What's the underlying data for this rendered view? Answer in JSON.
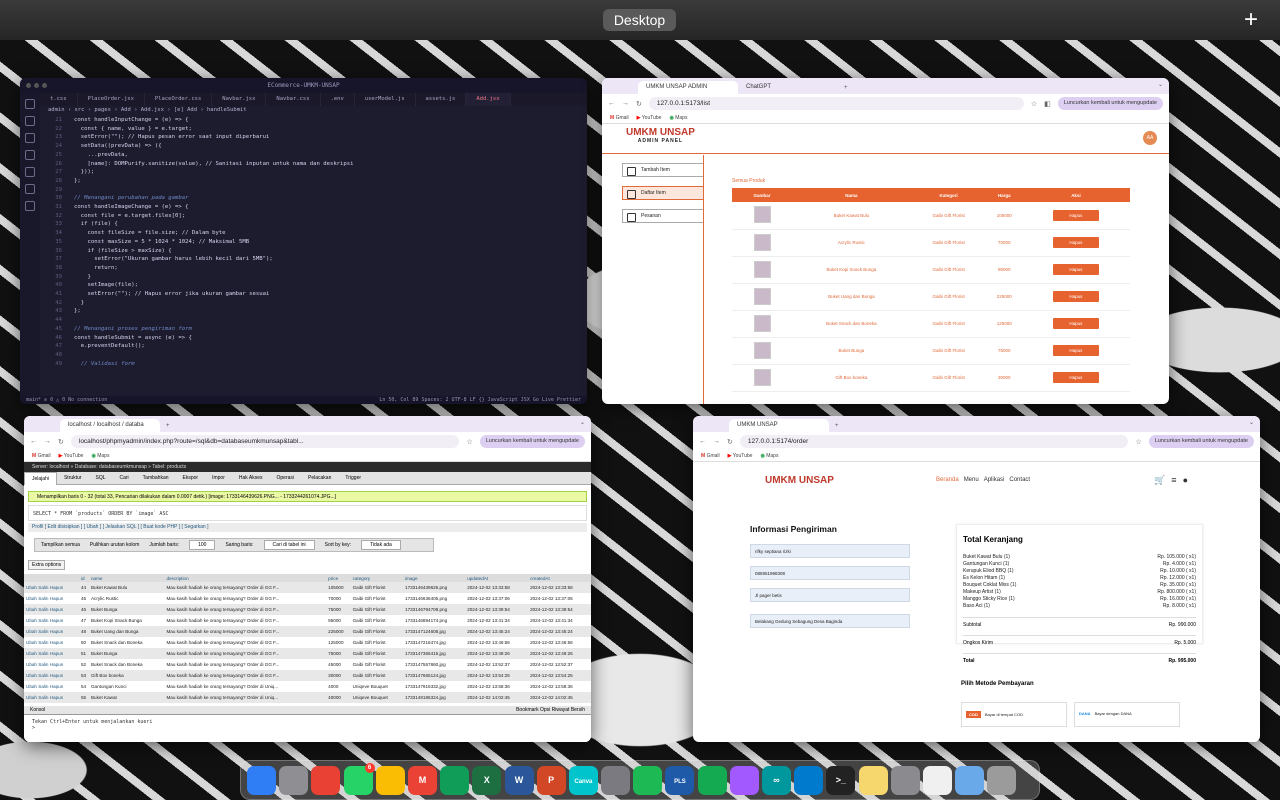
{
  "desktop": {
    "label": "Desktop",
    "add_space": "+"
  },
  "vscode": {
    "title": "ECommerce-UMKM-UNSAP",
    "tabs": [
      "t.css",
      "PlaceOrder.jsx",
      "PlaceOrder.css",
      "Navbar.jsx",
      "Navbar.css",
      ".env",
      "userModel.js",
      "assets.js",
      "Add.jsx"
    ],
    "breadcrumb": "admin › src › pages › Add › Add.jsx › [e] Add › handleSubmit",
    "lines": [
      {
        "n": "21",
        "t": "const handleInputChange = (e) => {"
      },
      {
        "n": "22",
        "t": "  const { name, value } = e.target;"
      },
      {
        "n": "23",
        "t": "  setError(\"\"); // Hapus pesan error saat input diperbarui"
      },
      {
        "n": "24",
        "t": "  setData((prevData) => ({"
      },
      {
        "n": "25",
        "t": "    ...prevData,"
      },
      {
        "n": "26",
        "t": "    [name]: DOMPurify.sanitize(value), // Sanitasi inputan untuk nama dan deskripsi"
      },
      {
        "n": "27",
        "t": "  }));"
      },
      {
        "n": "28",
        "t": "};"
      },
      {
        "n": "29",
        "t": ""
      },
      {
        "n": "30",
        "t": "// Menangani perubahan pada gambar"
      },
      {
        "n": "31",
        "t": "const handleImageChange = (e) => {"
      },
      {
        "n": "32",
        "t": "  const file = e.target.files[0];"
      },
      {
        "n": "33",
        "t": "  if (file) {"
      },
      {
        "n": "34",
        "t": "    const fileSize = file.size; // Dalam byte"
      },
      {
        "n": "35",
        "t": "    const maxSize = 5 * 1024 * 1024; // Maksimal 5MB"
      },
      {
        "n": "36",
        "t": "    if (fileSize > maxSize) {"
      },
      {
        "n": "37",
        "t": "      setError(\"Ukuran gambar harus lebih kecil dari 5MB\");"
      },
      {
        "n": "38",
        "t": "      return;"
      },
      {
        "n": "39",
        "t": "    }"
      },
      {
        "n": "40",
        "t": "    setImage(file);"
      },
      {
        "n": "41",
        "t": "    setError(\"\"); // Hapus error jika ukuran gambar sesuai"
      },
      {
        "n": "42",
        "t": "  }"
      },
      {
        "n": "43",
        "t": "};"
      },
      {
        "n": "44",
        "t": ""
      },
      {
        "n": "45",
        "t": "// Menangani proses pengiriman form"
      },
      {
        "n": "46",
        "t": "const handleSubmit = async (e) => {"
      },
      {
        "n": "47",
        "t": "  e.preventDefault();"
      },
      {
        "n": "48",
        "t": ""
      },
      {
        "n": "49",
        "t": "  // Validasi form"
      }
    ],
    "status_left": "main* ⊘ 0 △ 0   No connection",
    "status_right": "Ln 50, Col 89  Spaces: 2  UTF-8  LF  {} JavaScript JSX  Go Live  Prettier"
  },
  "admin": {
    "tabs": [
      "UMKM UNSAP ADMIN",
      "ChatGPT"
    ],
    "url": "127.0.0.1:5173/list",
    "update": "Luncurkan kembali untuk mengupdate",
    "bookmarks": [
      "Gmail",
      "YouTube",
      "Maps"
    ],
    "logo": "UMKM UNSAP",
    "logo_sub": "ADMIN PANEL",
    "avatar": "AA",
    "sidebar": [
      "Tambah Item",
      "Daftar Item",
      "Pesanan"
    ],
    "caption": "Semua Produk",
    "headers": [
      "Gambar",
      "Nama",
      "Kategori",
      "Harga",
      "Aksi"
    ],
    "rows": [
      {
        "name": "Buket Kawat Bulu",
        "cat": "Gaibi Gift Florist",
        "price": "105000"
      },
      {
        "name": "Acrylic Rustic",
        "cat": "Gaibi Gift Florist",
        "price": "70000"
      },
      {
        "name": "Buket Kopi Snack Bunga",
        "cat": "Gaibi Gift Florist",
        "price": "95000"
      },
      {
        "name": "Buket Uang dan Bunga",
        "cat": "Gaibi Gift Florist",
        "price": "225000"
      },
      {
        "name": "Buket Snack dan Boneka",
        "cat": "Gaibi Gift Florist",
        "price": "125000"
      },
      {
        "name": "Buket Bunga",
        "cat": "Gaibi Gift Florist",
        "price": "75000"
      },
      {
        "name": "Gift Box boneka",
        "cat": "Gaibi Gift Florist",
        "price": "30000"
      }
    ],
    "delete_label": "Hapus"
  },
  "pma": {
    "tab": "localhost / localhost / databa",
    "url": "localhost/phpmyadmin/index.php?route=/sql&db=databaseumkmunsap&tabl...",
    "update": "Luncurkan kembali untuk mengupdate",
    "bookmarks": [
      "Gmail",
      "YouTube",
      "Maps"
    ],
    "nav": "Server: localhost » Database: databaseumkmunsap » Tabel: products",
    "tabs": [
      "Jelajahi",
      "Struktur",
      "SQL",
      "Cari",
      "Tambahkan",
      "Ekspor",
      "Impor",
      "Hak Akses",
      "Operasi",
      "Pelacakan",
      "Trigger"
    ],
    "message": "Menampilkan baris 0 - 32 (total 33, Pencarian dilakukan dalam 0.0007 detik.) [image: 1733146439626.PNG... - 1733244261074.JPG...]",
    "sql": "SELECT * FROM `products` ORDER BY `image` ASC",
    "links": "Profil [ Edit disisipkan ] [ Ubah ] [ Jelaskan SQL ] [ Buat kode PHP ] [ Segarkan ]",
    "opt_all": "Tampilkan semua",
    "opt_cols": "Pulihkan urutan kolom",
    "opt_rows": "Jumlah baris:",
    "opt_rows_val": "100",
    "opt_filter": "Saring baris:",
    "opt_filter_ph": "Cari di tabel ini",
    "opt_sort": "Sort by key:",
    "opt_sort_val": "Tidak ada",
    "extra": "Extra options",
    "columns": [
      "",
      "id",
      "name",
      "description",
      "price",
      "category",
      "image",
      "updatedAt",
      "createdAt"
    ],
    "actions": "Ubah  Salin  Hapus",
    "rows": [
      [
        "44",
        "Buket Kawat Bulu",
        "Mau kasih hadiah ke orang tersayang? Order di GG F...",
        "105000",
        "Gaibi Gift Florist",
        "1733146439626.png",
        "2024-12-02 13:33:58",
        "2024-12-02 13:33:58"
      ],
      [
        "45",
        "Acrylic Rustic",
        "Mau kasih hadiah ke orang tersayang? Order di GG F...",
        "70000",
        "Gaibi Gift Florist",
        "1733146636405.png",
        "2024-12-02 13:37:06",
        "2024-12-02 13:37:06"
      ],
      [
        "46",
        "Buket Bunga",
        "Mau kasih hadiah ke orang tersayang? Order di GG F...",
        "75000",
        "Gaibi Gift Florist",
        "1733146794708.png",
        "2024-12-02 13:39:54",
        "2024-12-02 13:39:54"
      ],
      [
        "47",
        "Buket Kopi Snack Bunga",
        "Mau kasih hadiah ke orang tersayang? Order di GG F...",
        "95000",
        "Gaibi Gift Florist",
        "1733146894174.png",
        "2024-12-02 13:41:34",
        "2024-12-02 13:41:34"
      ],
      [
        "48",
        "Buket Uang dan Bunga",
        "Mau kasih hadiah ke orang tersayang? Order di GG F...",
        "225000",
        "Gaibi Gift Florist",
        "1733147124608.jpg",
        "2024-12-02 13:45:24",
        "2024-12-02 13:45:24"
      ],
      [
        "50",
        "Buket Snack dan Boneka",
        "Mau kasih hadiah ke orang tersayang? Order di GG F...",
        "125000",
        "Gaibi Gift Florist",
        "1733147216474.jpg",
        "2024-12-02 13:46:56",
        "2024-12-02 13:46:56"
      ],
      [
        "51",
        "Buket Bunga",
        "Mau kasih hadiah ke orang tersayang? Order di GG F...",
        "75000",
        "Gaibi Gift Florist",
        "1733147366415.jpg",
        "2024-12-02 13:49:26",
        "2024-12-02 13:49:26"
      ],
      [
        "52",
        "Buket Snack dan Boneka",
        "Mau kasih hadiah ke orang tersayang? Order di GG F...",
        "45000",
        "Gaibi Gift Florist",
        "1733147557860.jpg",
        "2024-12-02 13:52:37",
        "2024-12-02 13:52:37"
      ],
      [
        "53",
        "Gift Box boneka",
        "Mau kasih hadiah ke orang tersayang? Order di GG F...",
        "30000",
        "Gaibi Gift Florist",
        "1733147665124.jpg",
        "2024-12-02 13:54:25",
        "2024-12-02 13:54:25"
      ],
      [
        "54",
        "Gantungan Kunci",
        "Mau kasih hadiah ke orang tersayang? Order di Uniq...",
        "4000",
        "Uniqeve Bouquet",
        "1733147916332.jpg",
        "2024-12-02 13:58:36",
        "2024-12-02 13:58:36"
      ],
      [
        "55",
        "Buket Kawat",
        "Mau kasih hadiah ke orang tersayang? Order di Uniq...",
        "40000",
        "Uniqeve Bouquet",
        "1733148185324.jpg",
        "2024-12-02 14:02:45",
        "2024-12-02 14:02:45"
      ]
    ],
    "console_label": "Konsol",
    "console_right": "Bookmark   Opsi   Riwayat   Bersih",
    "console_hint": "Tekan Ctrl+Enter untuk menjalankan kueri",
    "prompt": ">"
  },
  "order": {
    "tab": "UMKM UNSAP",
    "url": "127.0.0.1:5174/order",
    "update": "Luncurkan kembali untuk mengupdate",
    "bookmarks": [
      "Gmail",
      "YouTube",
      "Maps"
    ],
    "logo": "UMKM UNSAP",
    "menu": [
      "Beranda",
      "Menu",
      "Aplikasi",
      "Contact"
    ],
    "ship_title": "Informasi Pengiriman",
    "fields": [
      "rifky septiana rizki",
      "085951998308",
      "Jl pager betis",
      "Belakang Gedung Sebagung Desa Baginda"
    ],
    "cart_title": "Total Keranjang",
    "items": [
      [
        "Buket Kawat Bulu (1)",
        "Rp. 105.000 ( x1)"
      ],
      [
        "Gantungan Kunci (1)",
        "Rp. 4.000 ( x1)"
      ],
      [
        "Kerupuk Eliod BBQ (1)",
        "Rp. 10.000 ( x1)"
      ],
      [
        "Es Kelon Hitam (1)",
        "Rp. 12.000 ( x1)"
      ],
      [
        "Bouquet Coklat Mixs (1)",
        "Rp. 35.000 ( x1)"
      ],
      [
        "Makeup Artist (1)",
        "Rp. 800.000 ( x1)"
      ],
      [
        "Manggo Sticky Rice (1)",
        "Rp. 16.000 ( x1)"
      ],
      [
        "Baso Aci (1)",
        "Rp. 8.000 ( x1)"
      ]
    ],
    "subtotal_label": "Subtotal",
    "subtotal": "Rp. 990.000",
    "shipping_label": "Ongkos Kirim",
    "shipping": "Rp. 5.000",
    "total_label": "Total",
    "total": "Rp. 995.000",
    "pay_title": "Pilih Metode Pembayaran",
    "pay_cod_tag": "COD",
    "pay_cod": "Bayar di tempat COD",
    "pay_dana_tag": "DANA",
    "pay_dana": "Bayar dengan DANA"
  },
  "dock": {
    "apps": [
      {
        "icon": "finder-icon",
        "color": "#2f7ef6",
        "label": ""
      },
      {
        "icon": "launchpad-icon",
        "color": "#8e8e93",
        "label": ""
      },
      {
        "icon": "chrome-icon",
        "color": "#e94235",
        "label": ""
      },
      {
        "icon": "whatsapp-icon",
        "color": "#25d366",
        "label": "",
        "badge": "6"
      },
      {
        "icon": "drive-icon",
        "color": "#fbbc04",
        "label": ""
      },
      {
        "icon": "gmail-icon",
        "color": "#ea4335",
        "label": "M"
      },
      {
        "icon": "sheets-icon",
        "color": "#0f9d58",
        "label": ""
      },
      {
        "icon": "excel-icon",
        "color": "#1d6f42",
        "label": "X"
      },
      {
        "icon": "word-icon",
        "color": "#2b579a",
        "label": "W"
      },
      {
        "icon": "powerpoint-icon",
        "color": "#d24726",
        "label": "P"
      },
      {
        "icon": "canva-icon",
        "color": "#00c4cc",
        "label": "Canva"
      },
      {
        "icon": "settings-icon",
        "color": "#7a7a80",
        "label": ""
      },
      {
        "icon": "spotify-like-icon",
        "color": "#1db954",
        "label": ""
      },
      {
        "icon": "pls-icon",
        "color": "#1e5aa8",
        "label": "PLS"
      },
      {
        "icon": "mongodb-icon",
        "color": "#13aa52",
        "label": ""
      },
      {
        "icon": "figma-icon",
        "color": "#a259ff",
        "label": ""
      },
      {
        "icon": "arduino-icon",
        "color": "#00979d",
        "label": "∞"
      },
      {
        "icon": "vscode-icon",
        "color": "#007acc",
        "label": ""
      },
      {
        "icon": "terminal-icon",
        "color": "#222222",
        "label": ">_"
      },
      {
        "icon": "notes-icon",
        "color": "#f5d76e",
        "label": ""
      },
      {
        "icon": "system-settings-icon",
        "color": "#8a8a8f",
        "label": ""
      },
      {
        "icon": "pages-icon",
        "color": "#f0f0f0",
        "label": ""
      },
      {
        "icon": "preview-icon",
        "color": "#6aa9e9",
        "label": ""
      },
      {
        "icon": "trash-icon",
        "color": "#9b9b9b",
        "label": ""
      }
    ]
  }
}
